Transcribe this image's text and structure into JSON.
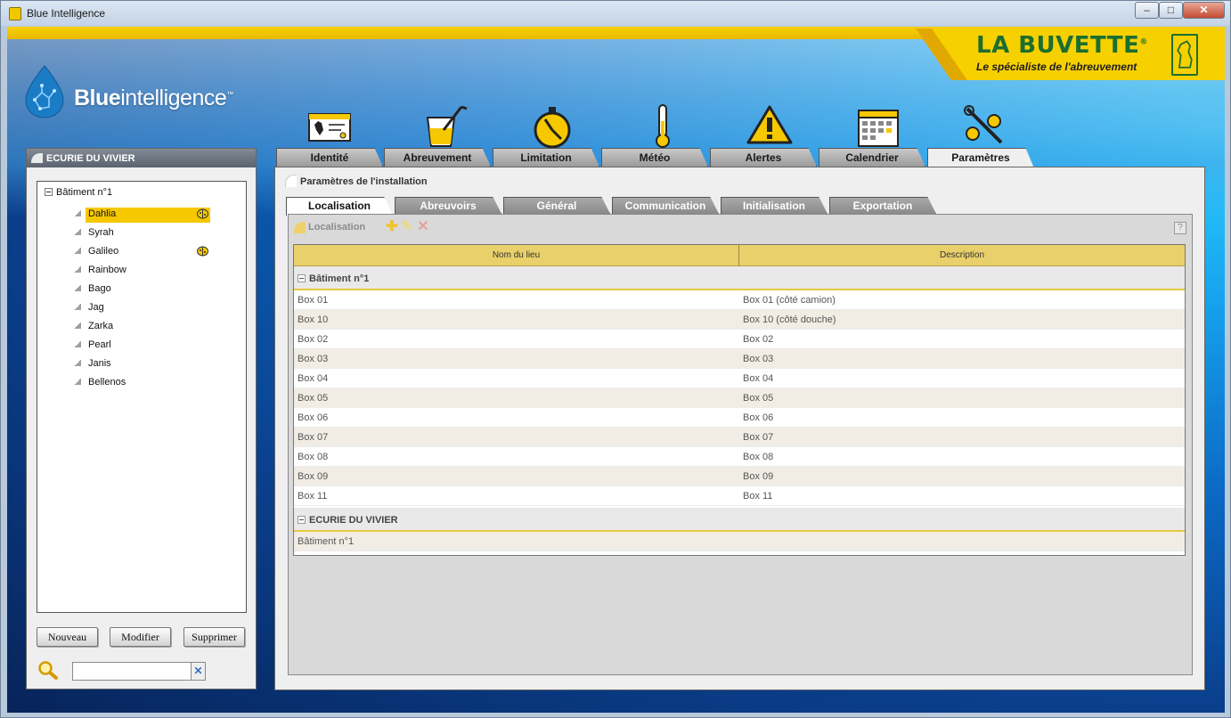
{
  "window": {
    "title": "Blue Intelligence",
    "minimize": "–",
    "maximize": "□",
    "close": "✕"
  },
  "branding": {
    "logo_bold": "Blue",
    "logo_light": "intelligence",
    "logo_tm": "™",
    "company": "LA BUVETTE",
    "company_mark": "®",
    "tagline": "Le spécialiste de l'abreuvement"
  },
  "left_panel": {
    "title": "ECURIE DU VIVIER",
    "tree_root": "Bâtiment n°1",
    "horses": [
      {
        "name": "Dahlia",
        "selected": true,
        "bug": true
      },
      {
        "name": "Syrah",
        "selected": false,
        "bug": false
      },
      {
        "name": "Galileo",
        "selected": false,
        "bug": true
      },
      {
        "name": "Rainbow",
        "selected": false,
        "bug": false
      },
      {
        "name": "Bago",
        "selected": false,
        "bug": false
      },
      {
        "name": "Jag",
        "selected": false,
        "bug": false
      },
      {
        "name": "Zarka",
        "selected": false,
        "bug": false
      },
      {
        "name": "Pearl",
        "selected": false,
        "bug": false
      },
      {
        "name": "Janis",
        "selected": false,
        "bug": false
      },
      {
        "name": "Bellenos",
        "selected": false,
        "bug": false
      }
    ],
    "buttons": {
      "new": "Nouveau",
      "edit": "Modifier",
      "delete": "Supprimer"
    },
    "search": {
      "value": "",
      "clear": "✕"
    }
  },
  "main_tabs": [
    {
      "label": "Identité",
      "icon": "id-card-icon"
    },
    {
      "label": "Abreuvement",
      "icon": "glass-icon"
    },
    {
      "label": "Limitation",
      "icon": "stopwatch-icon"
    },
    {
      "label": "Météo",
      "icon": "thermometer-icon"
    },
    {
      "label": "Alertes",
      "icon": "warning-icon"
    },
    {
      "label": "Calendrier",
      "icon": "calendar-icon"
    },
    {
      "label": "Paramètres",
      "icon": "tools-icon",
      "active": true
    }
  ],
  "main_panel": {
    "title": "Paramètres de l'installation",
    "sub_tabs": [
      "Localisation",
      "Abreuvoirs",
      "Général",
      "Communication",
      "Initialisation",
      "Exportation"
    ],
    "active_sub_tab": "Localisation",
    "section_title": "Localisation",
    "help": "?",
    "grid": {
      "columns": [
        "Nom du lieu",
        "Description"
      ],
      "groups": [
        {
          "label": "Bâtiment n°1",
          "rows": [
            [
              "Box 01",
              "Box 01 (côté camion)"
            ],
            [
              "Box 10",
              "Box 10 (côté douche)"
            ],
            [
              "Box 02",
              "Box 02"
            ],
            [
              "Box 03",
              "Box 03"
            ],
            [
              "Box 04",
              "Box 04"
            ],
            [
              "Box 05",
              "Box 05"
            ],
            [
              "Box 06",
              "Box 06"
            ],
            [
              "Box 07",
              "Box 07"
            ],
            [
              "Box 08",
              "Box 08"
            ],
            [
              "Box 09",
              "Box 09"
            ],
            [
              "Box 11",
              "Box 11"
            ]
          ]
        },
        {
          "label": "ECURIE DU VIVIER",
          "rows": [
            [
              "Bâtiment n°1",
              ""
            ]
          ]
        }
      ]
    }
  },
  "colors": {
    "accent_yellow": "#f5c800",
    "brand_green": "#1c6e2e",
    "grid_header": "#e9d06a"
  }
}
